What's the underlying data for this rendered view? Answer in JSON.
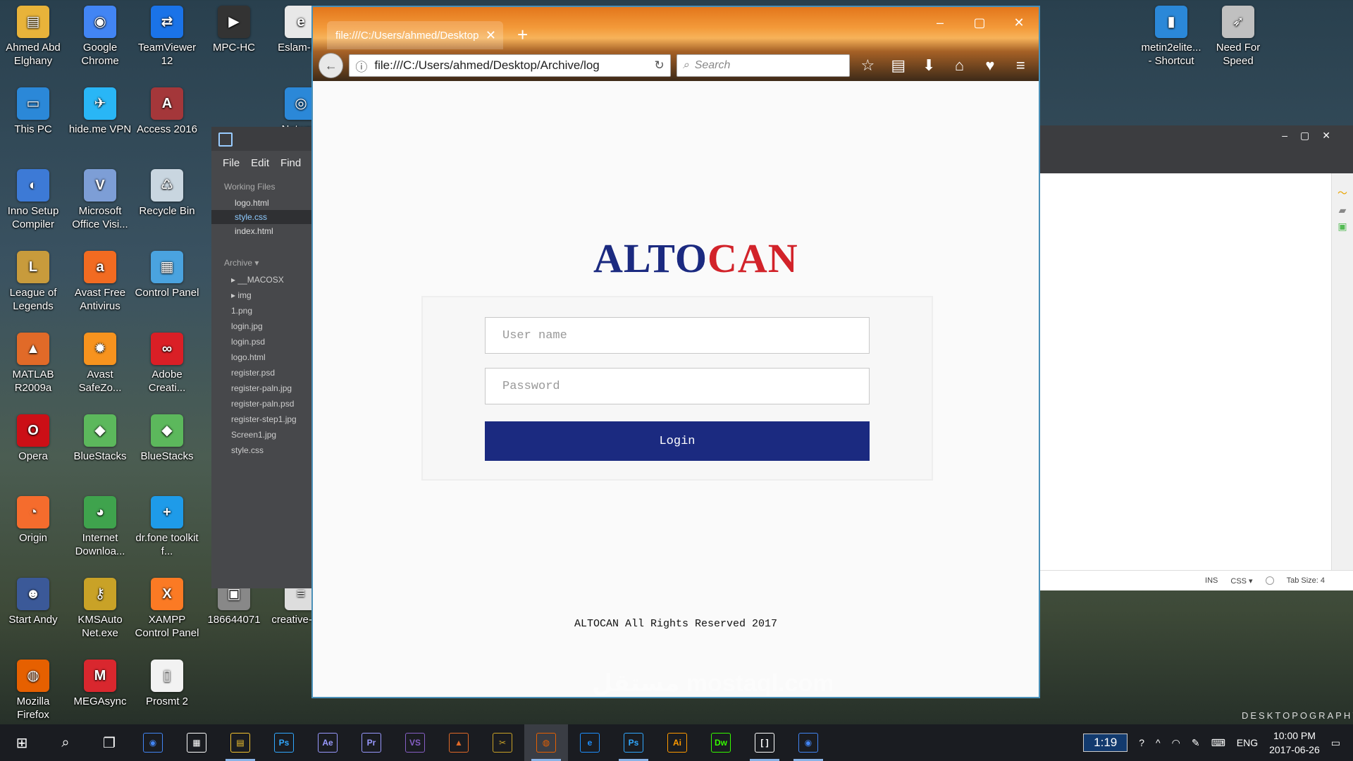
{
  "desktop_icons": [
    {
      "label": "Ahmed Abd Elghany",
      "icon": "folder-user-icon",
      "color": "#e8b33a",
      "glyph": "▤"
    },
    {
      "label": "Google Chrome",
      "icon": "chrome-icon",
      "color": "#4285f4",
      "glyph": "◉"
    },
    {
      "label": "TeamViewer 12",
      "icon": "teamviewer-icon",
      "color": "#1a73e8",
      "glyph": "⇄"
    },
    {
      "label": "MPC-HC",
      "icon": "mpc-hc-icon",
      "color": "#333333",
      "glyph": "▶"
    },
    {
      "label": "Eslam-FS",
      "icon": "pdf-icon",
      "color": "#e8e8e8",
      "glyph": "e"
    },
    {
      "label": "This PC",
      "icon": "computer-icon",
      "color": "#2b88d8",
      "glyph": "▭"
    },
    {
      "label": "hide.me VPN",
      "icon": "vpn-icon",
      "color": "#29b6f6",
      "glyph": "✈"
    },
    {
      "label": "Access 2016",
      "icon": "access-icon",
      "color": "#a4373a",
      "glyph": "A"
    },
    {
      "label": "Network",
      "icon": "network-icon",
      "color": "#2b88d8",
      "glyph": "◎"
    },
    {
      "label": "Inno Setup Compiler",
      "icon": "inno-setup-icon",
      "color": "#3d7ad6",
      "glyph": "◐"
    },
    {
      "label": "Microsoft Office Visi...",
      "icon": "visio-icon",
      "color": "#7d9ed6",
      "glyph": "V"
    },
    {
      "label": "Recycle Bin",
      "icon": "recycle-bin-icon",
      "color": "#c9d6e0",
      "glyph": "♺"
    },
    {
      "label": "League of Legends",
      "icon": "lol-icon",
      "color": "#c89b3c",
      "glyph": "L"
    },
    {
      "label": "Avast Free Antivirus",
      "icon": "avast-icon",
      "color": "#f26b21",
      "glyph": "a"
    },
    {
      "label": "Control Panel",
      "icon": "control-panel-icon",
      "color": "#4aa3df",
      "glyph": "▦"
    },
    {
      "label": "MATLAB R2009a",
      "icon": "matlab-icon",
      "color": "#e16a28",
      "glyph": "▲"
    },
    {
      "label": "Avast SafeZo...",
      "icon": "avast-safezone-icon",
      "color": "#f7931e",
      "glyph": "✹"
    },
    {
      "label": "Adobe Creati...",
      "icon": "adobe-cc-icon",
      "color": "#da1f26",
      "glyph": "∞"
    },
    {
      "label": "Opera",
      "icon": "opera-icon",
      "color": "#cc0f16",
      "glyph": "O"
    },
    {
      "label": "BlueStacks",
      "icon": "bluestacks-icon",
      "color": "#5cb85c",
      "glyph": "◆"
    },
    {
      "label": "BlueStacks",
      "icon": "bluestacks-icon",
      "color": "#5cb85c",
      "glyph": "◆"
    },
    {
      "label": "Origin",
      "icon": "origin-icon",
      "color": "#f56c2d",
      "glyph": "◔"
    },
    {
      "label": "Internet Downloa...",
      "icon": "idm-icon",
      "color": "#3fa34d",
      "glyph": "◕"
    },
    {
      "label": "dr.fone toolkit f...",
      "icon": "drfone-icon",
      "color": "#1e9be9",
      "glyph": "+"
    },
    {
      "label": "Start Andy",
      "icon": "andy-icon",
      "color": "#3b5998",
      "glyph": "☻"
    },
    {
      "label": "KMSAuto Net.exe",
      "icon": "kmsauto-icon",
      "color": "#c9a227",
      "glyph": "⚷"
    },
    {
      "label": "XAMPP Control Panel",
      "icon": "xampp-icon",
      "color": "#fb7a24",
      "glyph": "X"
    },
    {
      "label": "186644071",
      "icon": "image-icon",
      "color": "#888888",
      "glyph": "▣"
    },
    {
      "label": "creative-re...",
      "icon": "document-icon",
      "color": "#dddddd",
      "glyph": "≡"
    },
    {
      "label": "Mozilla Firefox",
      "icon": "firefox-icon",
      "color": "#e66000",
      "glyph": "◍"
    },
    {
      "label": "MEGAsync",
      "icon": "mega-icon",
      "color": "#d9272e",
      "glyph": "M"
    },
    {
      "label": "Prosmt 2",
      "icon": "document-icon",
      "color": "#f2f2f2",
      "glyph": "▯"
    },
    {
      "label": "metin2elite... - Shortcut",
      "icon": "shortcut-icon",
      "color": "#2b88d8",
      "glyph": "▮"
    },
    {
      "label": "Need For Speed",
      "icon": "nfs-icon",
      "color": "#c0c0c0",
      "glyph": "➶"
    }
  ],
  "brackets": {
    "menu": [
      "File",
      "Edit",
      "Find"
    ],
    "working_files_label": "Working Files",
    "working_files": [
      "logo.html",
      "style.css",
      "index.html"
    ],
    "selected_file": "style.css",
    "project_label": "Archive ▾",
    "tree": [
      "▸ __MACOSX",
      "▸ img",
      "1.png",
      "login.jpg",
      "login.psd",
      "logo.html",
      "register.psd",
      "register-paln.jpg",
      "register-paln.psd",
      "register-step1.jpg",
      "Screen1.jpg",
      "style.css"
    ],
    "status": {
      "ins": "INS",
      "lang": "CSS ▾",
      "tab": "Tab Size: 4"
    }
  },
  "browser": {
    "tab_title": "file:///C:/Users/ahmed/Desktop",
    "url": "file:///C:/Users/ahmed/Desktop/Archive/log",
    "search_placeholder": "Search"
  },
  "page": {
    "logo_part1": "ALTO",
    "logo_part2": "C",
    "logo_part3": "AN",
    "username_placeholder": "User name",
    "password_placeholder": "Password",
    "login_label": "Login",
    "footer": "ALTOCAN All Rights Reserved 2017",
    "colors": {
      "brand_blue": "#1b2a80",
      "brand_red": "#d2232a"
    }
  },
  "watermark": "مستقل mostaql.com",
  "wallpaper_brand": "DESKTOPOGRAPHY",
  "taskbar": {
    "apps": [
      {
        "name": "chrome",
        "glyph": "◉",
        "color": "#4285f4"
      },
      {
        "name": "store",
        "glyph": "▦",
        "color": "#ffffff"
      },
      {
        "name": "file-explorer",
        "glyph": "▤",
        "color": "#f4c430"
      },
      {
        "name": "photoshop",
        "glyph": "Ps",
        "color": "#31a8ff"
      },
      {
        "name": "after-effects",
        "glyph": "Ae",
        "color": "#9999ff"
      },
      {
        "name": "premiere",
        "glyph": "Pr",
        "color": "#9999ff"
      },
      {
        "name": "visual-studio",
        "glyph": "VS",
        "color": "#865fc5"
      },
      {
        "name": "matlab",
        "glyph": "▲",
        "color": "#e16a28"
      },
      {
        "name": "tools",
        "glyph": "✂",
        "color": "#c9a227"
      },
      {
        "name": "firefox",
        "glyph": "◍",
        "color": "#e66000"
      },
      {
        "name": "edge",
        "glyph": "e",
        "color": "#1e90ff"
      },
      {
        "name": "photoshop-2",
        "glyph": "Ps",
        "color": "#31a8ff"
      },
      {
        "name": "illustrator",
        "glyph": "Ai",
        "color": "#ff9a00"
      },
      {
        "name": "dreamweaver",
        "glyph": "Dw",
        "color": "#35fa00"
      },
      {
        "name": "brackets",
        "glyph": "[ ]",
        "color": "#ffffff"
      },
      {
        "name": "chrome-2",
        "glyph": "◉",
        "color": "#4285f4"
      }
    ],
    "timer": "1:19",
    "lang": "ENG",
    "time": "10:00 PM",
    "date": "2017-06-26"
  }
}
